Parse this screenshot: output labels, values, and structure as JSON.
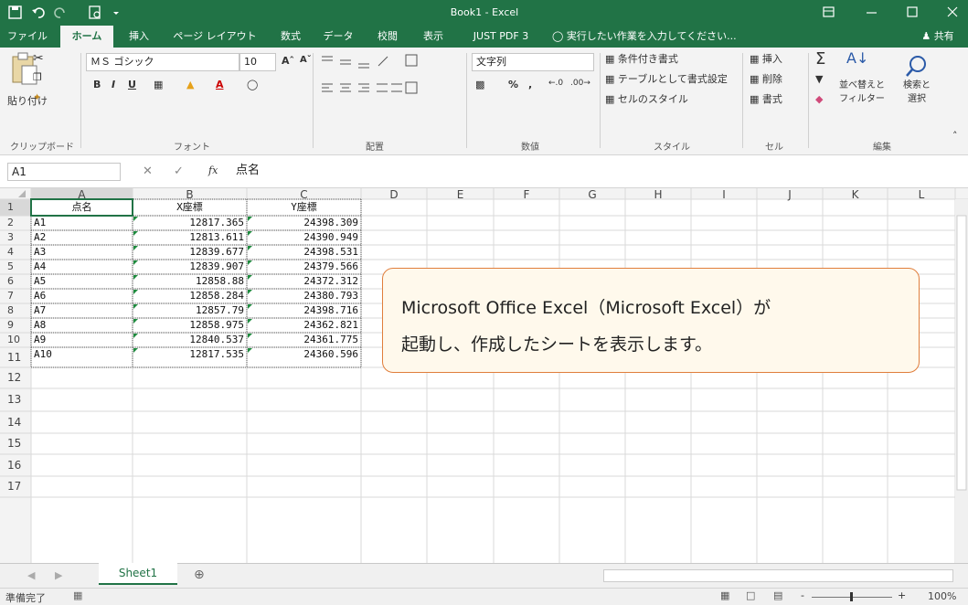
{
  "title_bar": {
    "doc_title": "Book1 - Excel"
  },
  "ribbon_tabs": [
    "ファイル",
    "ホーム",
    "挿入",
    "ページ レイアウト",
    "数式",
    "データ",
    "校閲",
    "表示",
    "JUST PDF 3"
  ],
  "tell_me": "実行したい作業を入力してください...",
  "share_label": "共有",
  "ribbon": {
    "paste_label": "貼り付け",
    "font_name": "ＭＳ ゴシック",
    "font_size": "10",
    "number_format": "文字列",
    "cond_format": "条件付き書式",
    "format_as_table": "テーブルとして書式設定",
    "cell_styles": "セルのスタイル",
    "insert": "挿入",
    "delete": "削除",
    "format": "書式",
    "sort_filter": [
      "並べ替えと",
      "フィルター"
    ],
    "find_select": [
      "検索と",
      "選択"
    ],
    "groups": {
      "clipboard": "クリップボード",
      "font": "フォント",
      "alignment": "配置",
      "number": "数値",
      "styles": "スタイル",
      "cells": "セル",
      "editing": "編集"
    }
  },
  "formula_bar": {
    "name_box": "A1",
    "fx": "fx",
    "content": "点名"
  },
  "columns": [
    "A",
    "B",
    "C",
    "D",
    "E",
    "F",
    "G",
    "H",
    "I",
    "J",
    "K",
    "L"
  ],
  "rows": [
    "1",
    "2",
    "3",
    "4",
    "5",
    "6",
    "7",
    "8",
    "9",
    "10",
    "11",
    "12",
    "13",
    "14",
    "15",
    "16",
    "17"
  ],
  "table": {
    "headers": [
      "点名",
      "X座標",
      "Y座標"
    ],
    "data": [
      [
        "A1",
        "12817.365",
        "24398.309"
      ],
      [
        "A2",
        "12813.611",
        "24390.949"
      ],
      [
        "A3",
        "12839.677",
        "24398.531"
      ],
      [
        "A4",
        "12839.907",
        "24379.566"
      ],
      [
        "A5",
        "12858.88",
        "24372.312"
      ],
      [
        "A6",
        "12858.284",
        "24380.793"
      ],
      [
        "A7",
        "12857.79",
        "24398.716"
      ],
      [
        "A8",
        "12858.975",
        "24362.821"
      ],
      [
        "A9",
        "12840.537",
        "24361.775"
      ],
      [
        "A10",
        "12817.535",
        "24360.596"
      ]
    ]
  },
  "callout": {
    "line1": "Microsoft Office Excel（Microsoft Excel）が",
    "line2": "起動し、作成したシートを表示します。"
  },
  "sheet_tab": "Sheet1",
  "status": {
    "ready": "準備完了",
    "zoom": "100%"
  },
  "colors": {
    "excel_green": "#217346",
    "callout_border": "#e07e3c",
    "callout_fill": "#fff9ec"
  }
}
